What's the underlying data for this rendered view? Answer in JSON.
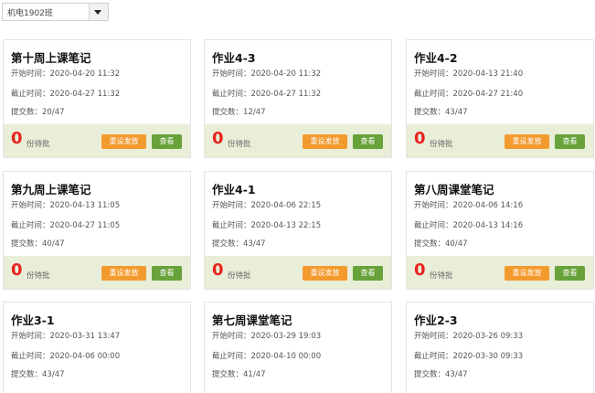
{
  "class_select": {
    "value": "机电1902班"
  },
  "labels": {
    "start": "开始时间：",
    "deadline": "截止时间：",
    "submitted": "提交数：",
    "pending": "份待批",
    "reset_btn": "重设发放",
    "view_btn": "查看"
  },
  "cards": [
    {
      "title": "第十周上课笔记",
      "start": "2020-04-20 11:32",
      "deadline": "2020-04-27 11:32",
      "submitted": "20/47",
      "pending_count": "0"
    },
    {
      "title": "作业4-3",
      "start": "2020-04-20 11:32",
      "deadline": "2020-04-27 11:32",
      "submitted": "12/47",
      "pending_count": "0"
    },
    {
      "title": "作业4-2",
      "start": "2020-04-13 21:40",
      "deadline": "2020-04-27 21:40",
      "submitted": "43/47",
      "pending_count": "0"
    },
    {
      "title": "第九周上课笔记",
      "start": "2020-04-13 11:05",
      "deadline": "2020-04-27 11:05",
      "submitted": "40/47",
      "pending_count": "0"
    },
    {
      "title": "作业4-1",
      "start": "2020-04-06 22:15",
      "deadline": "2020-04-13 22:15",
      "submitted": "43/47",
      "pending_count": "0"
    },
    {
      "title": "第八周课堂笔记",
      "start": "2020-04-06 14:16",
      "deadline": "2020-04-13 14:16",
      "submitted": "40/47",
      "pending_count": "0"
    },
    {
      "title": "作业3-1",
      "start": "2020-03-31 13:47",
      "deadline": "2020-04-06 00:00",
      "submitted": "43/47"
    },
    {
      "title": "第七周课堂笔记",
      "start": "2020-03-29 19:03",
      "deadline": "2020-04-10 00:00",
      "submitted": "41/47"
    },
    {
      "title": "作业2-3",
      "start": "2020-03-26 09:33",
      "deadline": "2020-03-30 09:33",
      "submitted": "43/47"
    }
  ]
}
